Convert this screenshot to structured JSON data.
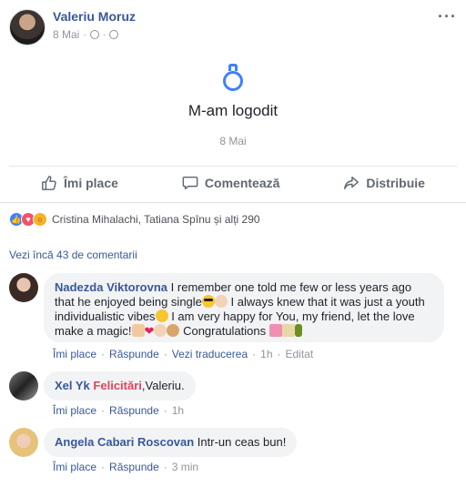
{
  "post": {
    "author": "Valeriu Moruz",
    "date": "8 Mai",
    "menu_icon": "more-icon",
    "event": {
      "icon": "ring-icon",
      "title": "M-am logodit",
      "date": "8 Mai"
    },
    "actions": {
      "like": "Îmi place",
      "comment": "Comentează",
      "share": "Distribuie"
    },
    "reactions": {
      "types": [
        "like",
        "love",
        "wow"
      ],
      "text": "Cristina Mihalachi, Tatiana Spînu și alți 290"
    },
    "view_more_comments": "Vezi încă 43 de comentarii"
  },
  "comments": [
    {
      "name": "Nadezda Viktorovna",
      "part1": "I remember one told me few or less years ago that he enjoyed being single",
      "part2": "I always knew that it was just a youth individualistic vibes",
      "part3": "I am very happy for You, my friend, let the love make a magic!",
      "part4": "Congratulations",
      "like": "Îmi place",
      "reply": "Răspunde",
      "translate": "Vezi traducerea",
      "time": "1h",
      "edited": "Editat"
    },
    {
      "name": "Xel Yk",
      "mention": "Felicitări",
      "text": ",Valeriu.",
      "like": "Îmi place",
      "reply": "Răspunde",
      "time": "1h"
    },
    {
      "name": "Angela Cabari Roscovan",
      "text": "Intr-un ceas bun!",
      "like": "Îmi place",
      "reply": "Răspunde",
      "time": "3 min"
    }
  ],
  "colors": {
    "link": "#385898",
    "accent": "#4080ff",
    "muted": "#90949c",
    "bubble": "#f2f3f5"
  }
}
